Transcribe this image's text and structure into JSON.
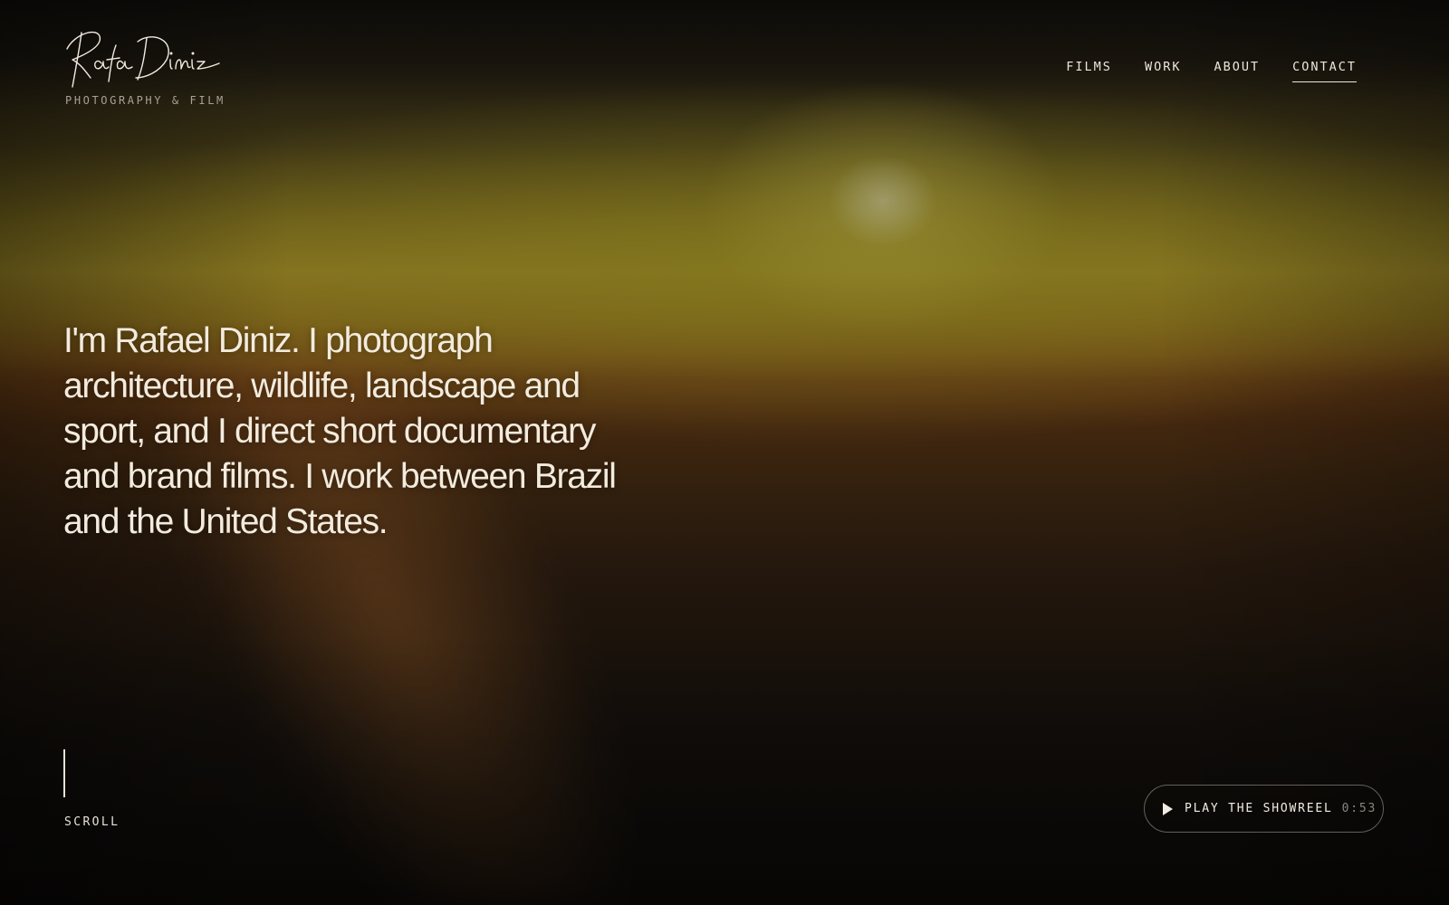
{
  "brand": {
    "name": "Rafa Diniz",
    "tagline": "PHOTOGRAPHY & FILM"
  },
  "nav": {
    "items": [
      {
        "label": "FILMS",
        "active": false
      },
      {
        "label": "WORK",
        "active": false
      },
      {
        "label": "ABOUT",
        "active": false
      },
      {
        "label": "CONTACT",
        "active": true
      }
    ]
  },
  "hero": {
    "text": "I'm Rafael Diniz. I photograph architecture, wildlife, landscape and sport, and I direct short documentary and brand films. I work between Brazil and the United States."
  },
  "scroll": {
    "label": "SCROLL"
  },
  "showreel": {
    "label": "PLAY THE SHOWREEL",
    "duration": "0:53",
    "icon": "play-icon"
  },
  "colors": {
    "text": "#f3ebdd",
    "muted": "#8a857d",
    "background": "#0b0a09",
    "sky_glow": "#867321"
  }
}
